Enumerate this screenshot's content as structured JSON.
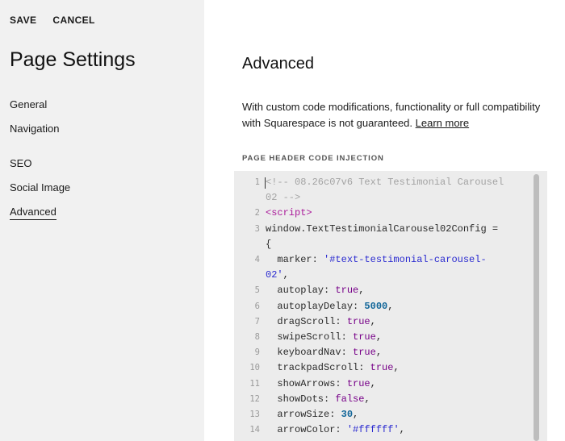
{
  "toolbar": {
    "save_label": "SAVE",
    "cancel_label": "CANCEL"
  },
  "sidebar": {
    "title": "Page Settings",
    "items": [
      {
        "label": "General"
      },
      {
        "label": "Navigation"
      },
      {
        "label": "SEO"
      },
      {
        "label": "Social Image"
      },
      {
        "label": "Advanced",
        "active": true
      }
    ]
  },
  "main": {
    "heading": "Advanced",
    "description_line1": "With custom code modifications, functionality or full compatibility",
    "description_line2_prefix": "with Squarespace is not guaranteed. ",
    "learn_more": "Learn more",
    "field_label": "PAGE HEADER CODE INJECTION",
    "code": [
      {
        "num": "1",
        "segments": [
          {
            "t": "<!-- 08.26c07v6 Text Testimonial Carousel",
            "c": "comment"
          }
        ]
      },
      {
        "num": "",
        "segments": [
          {
            "t": "02 -->",
            "c": "comment"
          }
        ]
      },
      {
        "num": "2",
        "segments": [
          {
            "t": "<script>",
            "c": "tag"
          }
        ]
      },
      {
        "num": "3",
        "segments": [
          {
            "t": "window.TextTestimonialCarousel02Config =",
            "c": "plain"
          }
        ]
      },
      {
        "num": "",
        "segments": [
          {
            "t": "{",
            "c": "plain"
          }
        ]
      },
      {
        "num": "4",
        "segments": [
          {
            "t": "  marker: ",
            "c": "plain"
          },
          {
            "t": "'#text-testimonial-carousel-",
            "c": "str"
          }
        ]
      },
      {
        "num": "",
        "segments": [
          {
            "t": "02'",
            "c": "str"
          },
          {
            "t": ",",
            "c": "plain"
          }
        ]
      },
      {
        "num": "5",
        "segments": [
          {
            "t": "  autoplay: ",
            "c": "plain"
          },
          {
            "t": "true",
            "c": "bool"
          },
          {
            "t": ",",
            "c": "plain"
          }
        ]
      },
      {
        "num": "6",
        "segments": [
          {
            "t": "  autoplayDelay: ",
            "c": "plain"
          },
          {
            "t": "5000",
            "c": "num"
          },
          {
            "t": ",",
            "c": "plain"
          }
        ]
      },
      {
        "num": "7",
        "segments": [
          {
            "t": "  dragScroll: ",
            "c": "plain"
          },
          {
            "t": "true",
            "c": "bool"
          },
          {
            "t": ",",
            "c": "plain"
          }
        ]
      },
      {
        "num": "8",
        "segments": [
          {
            "t": "  swipeScroll: ",
            "c": "plain"
          },
          {
            "t": "true",
            "c": "bool"
          },
          {
            "t": ",",
            "c": "plain"
          }
        ]
      },
      {
        "num": "9",
        "segments": [
          {
            "t": "  keyboardNav: ",
            "c": "plain"
          },
          {
            "t": "true",
            "c": "bool"
          },
          {
            "t": ",",
            "c": "plain"
          }
        ]
      },
      {
        "num": "10",
        "segments": [
          {
            "t": "  trackpadScroll: ",
            "c": "plain"
          },
          {
            "t": "true",
            "c": "bool"
          },
          {
            "t": ",",
            "c": "plain"
          }
        ]
      },
      {
        "num": "11",
        "segments": [
          {
            "t": "  showArrows: ",
            "c": "plain"
          },
          {
            "t": "true",
            "c": "bool"
          },
          {
            "t": ",",
            "c": "plain"
          }
        ]
      },
      {
        "num": "12",
        "segments": [
          {
            "t": "  showDots: ",
            "c": "plain"
          },
          {
            "t": "false",
            "c": "bool"
          },
          {
            "t": ",",
            "c": "plain"
          }
        ]
      },
      {
        "num": "13",
        "segments": [
          {
            "t": "  arrowSize: ",
            "c": "plain"
          },
          {
            "t": "30",
            "c": "num"
          },
          {
            "t": ",",
            "c": "plain"
          }
        ]
      },
      {
        "num": "14",
        "segments": [
          {
            "t": "  arrowColor: ",
            "c": "plain"
          },
          {
            "t": "'#ffffff'",
            "c": "str"
          },
          {
            "t": ",",
            "c": "plain"
          }
        ]
      }
    ]
  }
}
